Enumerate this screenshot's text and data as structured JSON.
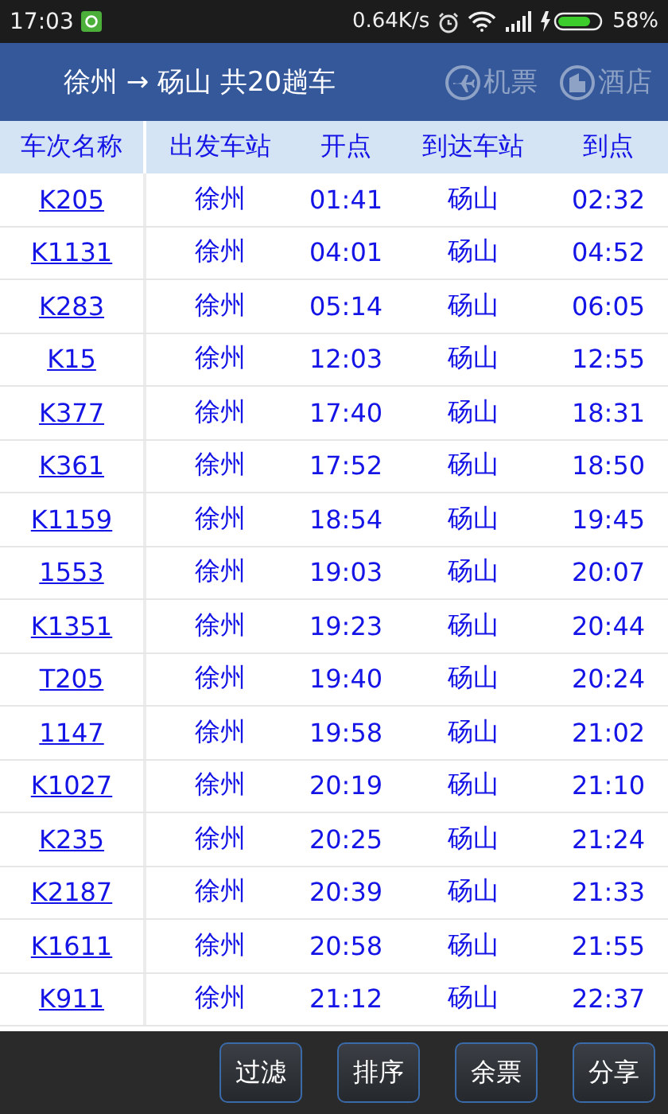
{
  "status_bar": {
    "time": "17:03",
    "speed": "0.64K/s",
    "battery": "58%"
  },
  "header": {
    "title": "徐州 → 砀山 共20趟车",
    "actions": [
      {
        "kind": "plane",
        "label": "机票"
      },
      {
        "kind": "hotel",
        "label": "酒店"
      }
    ]
  },
  "table": {
    "columns": [
      "车次名称",
      "出发车站",
      "开点",
      "到达车站",
      "到点"
    ],
    "rows": [
      [
        "K205",
        "徐州",
        "01:41",
        "砀山",
        "02:32"
      ],
      [
        "K1131",
        "徐州",
        "04:01",
        "砀山",
        "04:52"
      ],
      [
        "K283",
        "徐州",
        "05:14",
        "砀山",
        "06:05"
      ],
      [
        "K15",
        "徐州",
        "12:03",
        "砀山",
        "12:55"
      ],
      [
        "K377",
        "徐州",
        "17:40",
        "砀山",
        "18:31"
      ],
      [
        "K361",
        "徐州",
        "17:52",
        "砀山",
        "18:50"
      ],
      [
        "K1159",
        "徐州",
        "18:54",
        "砀山",
        "19:45"
      ],
      [
        "1553",
        "徐州",
        "19:03",
        "砀山",
        "20:07"
      ],
      [
        "K1351",
        "徐州",
        "19:23",
        "砀山",
        "20:44"
      ],
      [
        "T205",
        "徐州",
        "19:40",
        "砀山",
        "20:24"
      ],
      [
        "1147",
        "徐州",
        "19:58",
        "砀山",
        "21:02"
      ],
      [
        "K1027",
        "徐州",
        "20:19",
        "砀山",
        "21:10"
      ],
      [
        "K235",
        "徐州",
        "20:25",
        "砀山",
        "21:24"
      ],
      [
        "K2187",
        "徐州",
        "20:39",
        "砀山",
        "21:33"
      ],
      [
        "K1611",
        "徐州",
        "20:58",
        "砀山",
        "21:55"
      ],
      [
        "K911",
        "徐州",
        "21:12",
        "砀山",
        "22:37"
      ]
    ]
  },
  "toolbar": {
    "buttons": [
      "过滤",
      "排序",
      "余票",
      "分享"
    ]
  }
}
